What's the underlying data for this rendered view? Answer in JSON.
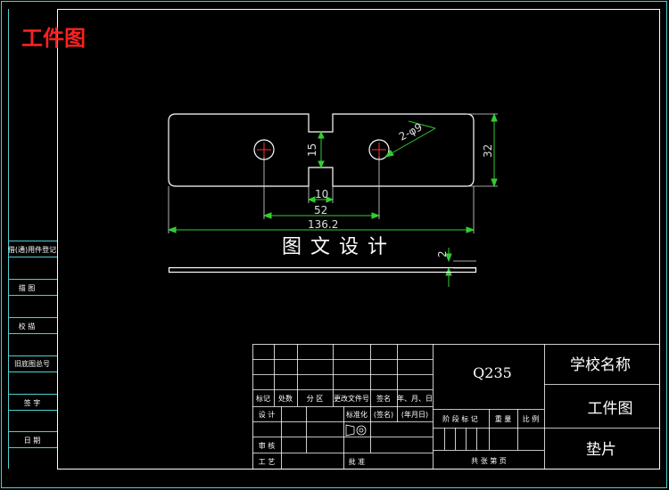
{
  "header": {
    "title": "工件图",
    "title_color": "#ff2020"
  },
  "colors": {
    "frame": "#4fd0d0",
    "dimension": "#33cc33",
    "outline": "#ffffff",
    "center": "#ff3030"
  },
  "drawing": {
    "caption": "图文设计",
    "dimensions": {
      "hole_spec": "2-φ9",
      "height": "32",
      "slot_height": "15",
      "slot_width": "10",
      "hole_spacing": "52",
      "overall_length": "136.2",
      "thickness": "2"
    }
  },
  "left_column": [
    "借(通)用件登记",
    "描 图",
    "校 描",
    "旧底图总号",
    "签 字",
    "日 期"
  ],
  "title_block": {
    "material": "Q235",
    "school": "学校名称",
    "drawing_type": "工件图",
    "part_name": "垫片",
    "revision_headers": [
      "标记",
      "处数",
      "分 区",
      "更改文件号",
      "签名",
      "年、月、日"
    ],
    "design_row": [
      "设 计",
      "标准化",
      "(签名)",
      "(年月日)"
    ],
    "stage_headers": [
      "阶 段 标 记",
      "重 量",
      "比 例"
    ],
    "review_label": "审 核",
    "process_label": "工 艺",
    "approve_label": "批 准",
    "sheets_text": "共    张    第    页"
  }
}
